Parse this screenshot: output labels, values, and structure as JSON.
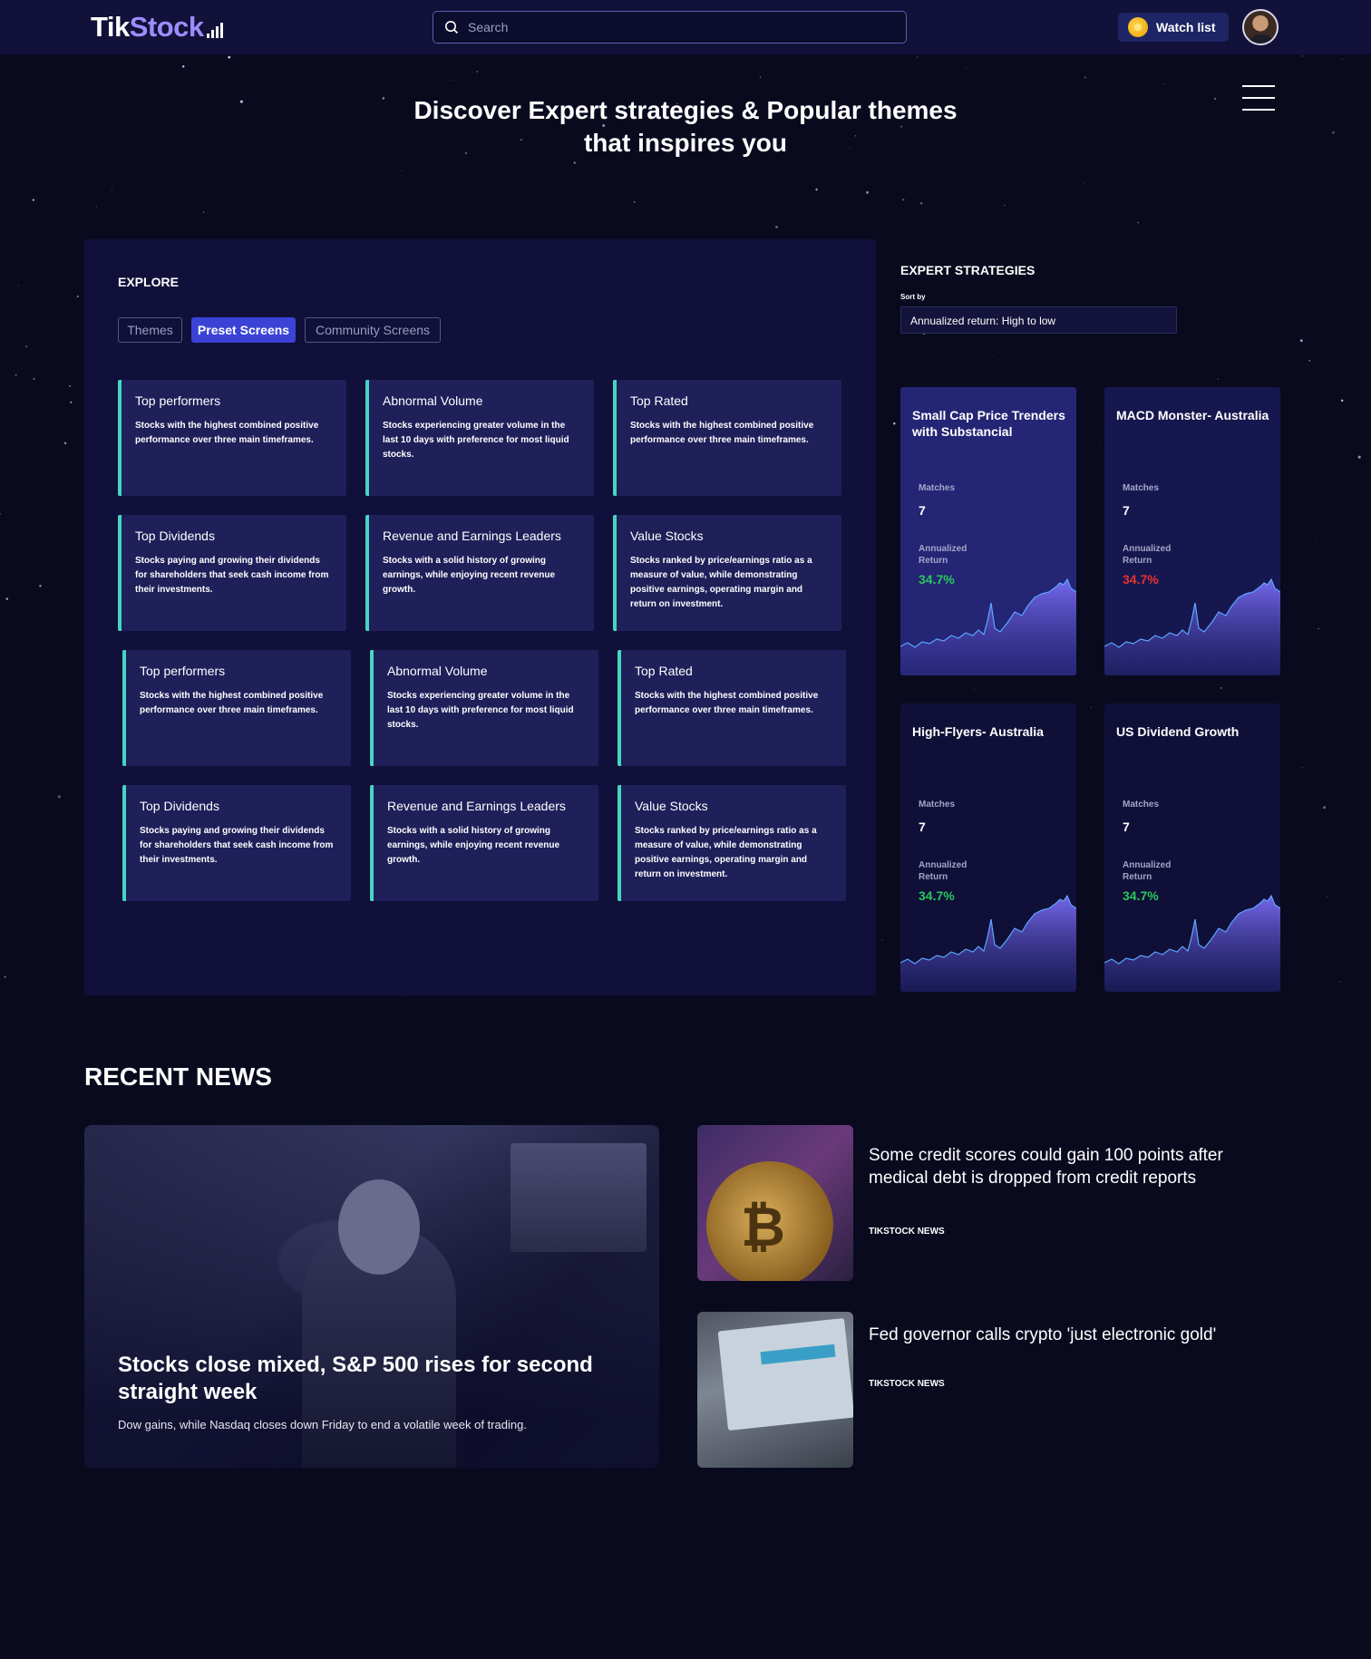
{
  "header": {
    "logo_tik": "Tik",
    "logo_stock": "Stock",
    "search_placeholder": "Search",
    "watchlist_label": "Watch list"
  },
  "hero": {
    "title_line1": "Discover Expert strategies & Popular themes",
    "title_line2": "that inspires you"
  },
  "explore": {
    "label": "EXPLORE",
    "tabs": [
      {
        "label": "Themes",
        "active": false
      },
      {
        "label": "Preset Screens",
        "active": true
      },
      {
        "label": "Community Screens",
        "active": false
      }
    ],
    "cards": [
      {
        "title": "Top performers",
        "desc": "Stocks with the highest combined positive performance over three main timeframes."
      },
      {
        "title": "Abnormal Volume",
        "desc": "Stocks experiencing greater volume in the last 10 days with preference for most liquid stocks."
      },
      {
        "title": "Top Rated",
        "desc": "Stocks with the highest combined positive performance over three main timeframes."
      },
      {
        "title": "Top Dividends",
        "desc": "Stocks paying and growing their dividends for shareholders that seek cash income from their investments."
      },
      {
        "title": "Revenue and Earnings Leaders",
        "desc": "Stocks with a solid history of growing earnings, while enjoying recent revenue growth."
      },
      {
        "title": "Value Stocks",
        "desc": "Stocks ranked by price/earnings ratio as a measure of value, while demonstrating positive earnings, operating margin and return on investment."
      },
      {
        "title": "Top performers",
        "desc": "Stocks with the highest combined positive performance over three main timeframes."
      },
      {
        "title": "Abnormal Volume",
        "desc": "Stocks experiencing greater volume in the last 10 days with preference for most liquid stocks."
      },
      {
        "title": "Top Rated",
        "desc": "Stocks with the highest combined positive performance over three main timeframes."
      },
      {
        "title": "Top Dividends",
        "desc": "Stocks paying and growing their dividends for shareholders that seek cash income from their investments."
      },
      {
        "title": "Revenue and Earnings Leaders",
        "desc": "Stocks with a solid history of growing earnings, while enjoying recent revenue growth."
      },
      {
        "title": "Value Stocks",
        "desc": "Stocks ranked by price/earnings ratio as a measure of value, while demonstrating positive earnings, operating margin and return on investment."
      }
    ]
  },
  "expert": {
    "title": "EXPERT STRATEGIES",
    "sort_label": "Sort by",
    "sort_value": "Annualized return: High to low",
    "strategies": [
      {
        "name": "Small Cap Price Trenders with Substancial",
        "matches_label": "Matches",
        "matches": "7",
        "return_label_1": "Annualized",
        "return_label_2": "Return",
        "return": "34.7%",
        "return_color": "#27c95a"
      },
      {
        "name": "MACD Monster- Australia",
        "matches_label": "Matches",
        "matches": "7",
        "return_label_1": "Annualized",
        "return_label_2": "Return",
        "return": "34.7%",
        "return_color": "#e8332f"
      },
      {
        "name": "High-Flyers- Australia",
        "matches_label": "Matches",
        "matches": "7",
        "return_label_1": "Annualized",
        "return_label_2": "Return",
        "return": "34.7%",
        "return_color": "#27c95a"
      },
      {
        "name": "US Dividend Growth",
        "matches_label": "Matches",
        "matches": "7",
        "return_label_1": "Annualized",
        "return_label_2": "Return",
        "return": "34.7%",
        "return_color": "#27c95a"
      }
    ]
  },
  "news": {
    "title": "RECENT NEWS",
    "feature": {
      "headline": "Stocks close mixed, S&P 500 rises for second straight week",
      "subhead": "Dow gains, while Nasdaq closes down Friday to end a volatile week of trading."
    },
    "items": [
      {
        "headline": "Some credit scores could gain 100 points after medical debt is dropped from credit reports",
        "source": "TIKSTOCK NEWS",
        "image": "bitcoin-image"
      },
      {
        "headline": "Fed governor calls crypto 'just electronic gold'",
        "source": "TIKSTOCK NEWS",
        "image": "credit-report-image"
      }
    ]
  }
}
